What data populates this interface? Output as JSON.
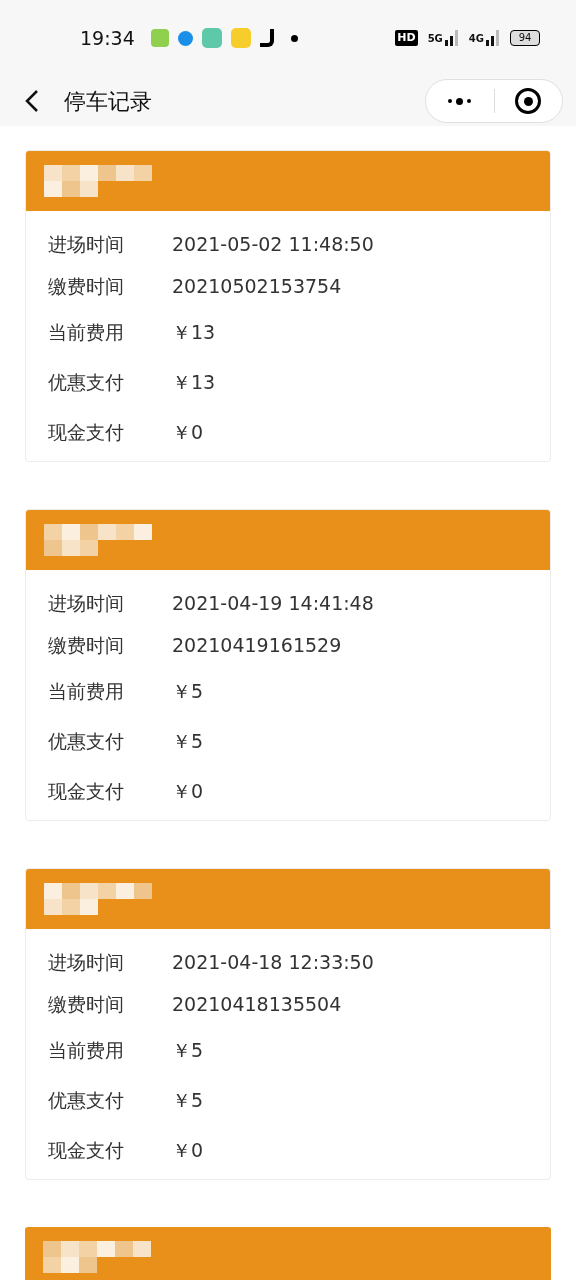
{
  "status_bar": {
    "time": "19:34",
    "indicators": [
      "HD",
      "5G",
      "4G"
    ],
    "battery": "94"
  },
  "nav": {
    "title": "停车记录"
  },
  "records": [
    {
      "rows": [
        {
          "label": "进场时间",
          "value": "2021-05-02 11:48:50"
        },
        {
          "label": "缴费时间",
          "value": "20210502153754"
        },
        {
          "label": "当前费用",
          "value": "￥13"
        },
        {
          "label": "优惠支付",
          "value": "￥13"
        },
        {
          "label": "现金支付",
          "value": "￥0"
        }
      ]
    },
    {
      "rows": [
        {
          "label": "进场时间",
          "value": "2021-04-19 14:41:48"
        },
        {
          "label": "缴费时间",
          "value": "20210419161529"
        },
        {
          "label": "当前费用",
          "value": "￥5"
        },
        {
          "label": "优惠支付",
          "value": "￥5"
        },
        {
          "label": "现金支付",
          "value": "￥0"
        }
      ]
    },
    {
      "rows": [
        {
          "label": "进场时间",
          "value": "2021-04-18 12:33:50"
        },
        {
          "label": "缴费时间",
          "value": "20210418135504"
        },
        {
          "label": "当前费用",
          "value": "￥5"
        },
        {
          "label": "优惠支付",
          "value": "￥5"
        },
        {
          "label": "现金支付",
          "value": "￥0"
        }
      ]
    },
    {
      "kind": "partial"
    }
  ]
}
